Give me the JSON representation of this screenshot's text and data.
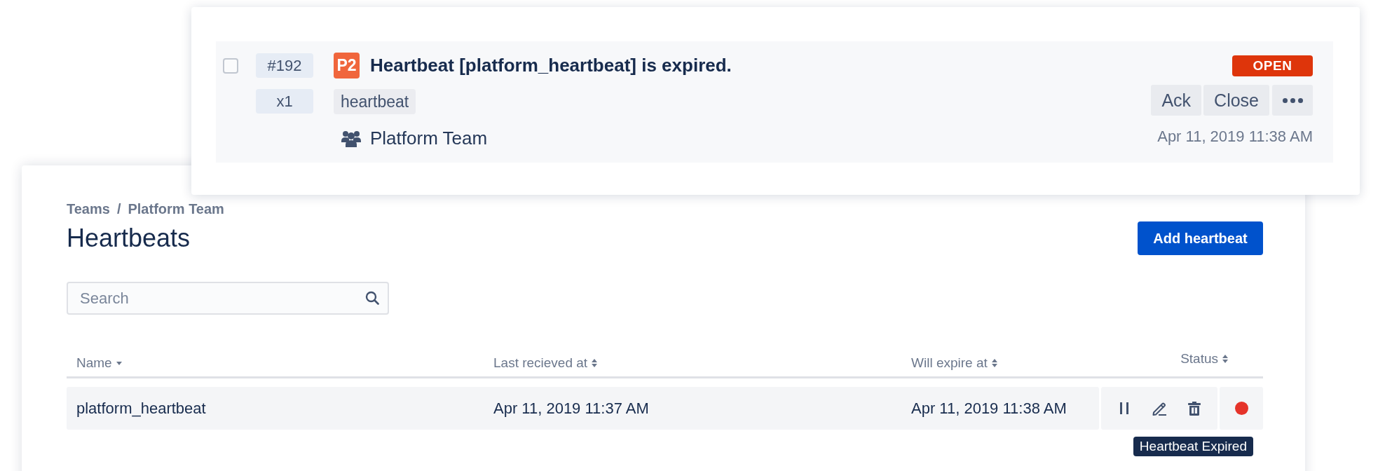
{
  "alert": {
    "checked": false,
    "number": "#192",
    "count": "x1",
    "priority": "P2",
    "title": "Heartbeat [platform_heartbeat] is expired.",
    "tags": [
      "heartbeat"
    ],
    "team": "Platform Team",
    "status": "OPEN",
    "actions": [
      "Ack",
      "Close"
    ],
    "time": "Apr 11, 2019 11:38 AM"
  },
  "breadcrumb": {
    "items": [
      "Teams",
      "Platform Team"
    ],
    "separator": "/"
  },
  "title": "Heartbeats",
  "add_button": "Add heartbeat",
  "search": {
    "placeholder": "Search"
  },
  "table": {
    "columns": [
      {
        "label": "Name",
        "sorted": true
      },
      {
        "label": "Last recieved at",
        "sorted": false
      },
      {
        "label": "Will expire at",
        "sorted": false
      },
      {
        "label": "Status",
        "sorted": false
      }
    ],
    "rows": [
      {
        "name": "platform_heartbeat",
        "last_received": "Apr 11, 2019 11:37 AM",
        "expires": "Apr 11, 2019 11:38 AM",
        "color": "#e5332a",
        "tooltip": "Heartbeat Expired"
      }
    ]
  }
}
